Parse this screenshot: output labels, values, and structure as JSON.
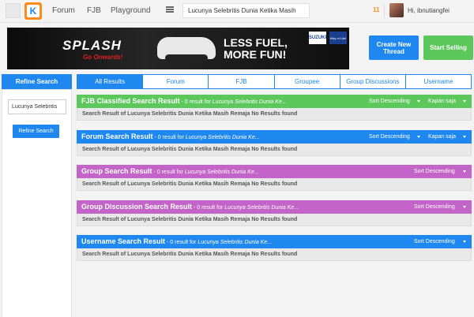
{
  "nav": {
    "forum": "Forum",
    "fjb": "FJB",
    "playground": "Playground",
    "search_value": "Lucunya Selebritis Dunia Ketika Masih",
    "notification_count": "11",
    "user_greeting": "Hi, ibnutiangfei"
  },
  "banner": {
    "brand": "SPLASH",
    "go": "Go Onwards!",
    "tagline_line1": "LESS FUEL,",
    "tagline_line2": "MORE FUN!",
    "maker": "SUZUKI",
    "way": "Way of Life!"
  },
  "actions": {
    "create_line1": "Create New",
    "create_line2": "Thread",
    "start_selling": "Start Selling"
  },
  "sidebar": {
    "title": "Refine Search",
    "input_value": "Lucunya Selebritis",
    "button": "Refine Search"
  },
  "tabs": [
    "All Results",
    "Forum",
    "FJB",
    "Groupee",
    "Group Discussions",
    "Username"
  ],
  "sections": [
    {
      "title": "FJB Classified Search Result",
      "count": " - 0 result for ",
      "keyword": "Lucunya Selebritis Dunia Ke...",
      "sort": "Sort Descending",
      "time": "Kapan saja",
      "body": "Search Result of Lucunya Selebritis Dunia Ketika Masih Remaja No Results found",
      "color": "#5cc85c"
    },
    {
      "title": "Forum Search Result",
      "count": " - 0 result for ",
      "keyword": "Lucunya Selebritis Dunia Ke...",
      "sort": "Sort Descending",
      "time": "Kapan saja",
      "body": "Search Result of Lucunya Selebritis Dunia Ketika Masih Remaja No Results found",
      "color": "#1e87f0"
    },
    {
      "title": "Group Search Result",
      "count": " - 0 result for ",
      "keyword": "Lucunya Selebritis Dunia Ke...",
      "sort": "Sort Descending",
      "body": "Search Result of Lucunya Selebritis Dunia Ketika Masih Remaja No Results found",
      "color": "#c364c8"
    },
    {
      "title": "Group Discussion Search Result",
      "count": " - 0 result for ",
      "keyword": "Lucunya Selebritis Dunia Ke...",
      "sort": "Sort Descending",
      "body": "Search Result of Lucunya Selebritis Dunia Ketika Masih Remaja No Results found",
      "color": "#c364c8"
    },
    {
      "title": "Username Search Result",
      "count": " - 0 result for ",
      "keyword": "Lucunya Selebritis Dunia Ke...",
      "sort": "Sort Descending",
      "body": "Search Result of Lucunya Selebritis Dunia Ketika Masih Remaja No Results found",
      "color": "#1e87f0"
    }
  ]
}
